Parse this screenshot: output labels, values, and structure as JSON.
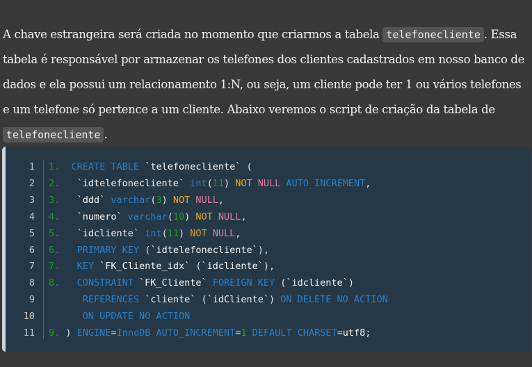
{
  "paragraph": {
    "t1": "A chave estrangeira será criada no momento que criarmos a tabela ",
    "c1": "telefonecliente",
    "t2": ". Essa tabela é responsável por armazenar os telefones dos clientes cadastrados em nosso banco de dados e ela possui um relacionamento 1:N, ou seja, um cliente pode ter 1 ou vários telefones e um telefone só pertence a um cliente. Abaixo veremos o script de criação da tabela de ",
    "c2": "telefonecliente",
    "t3": "."
  },
  "code": {
    "line_numbers": [
      "1",
      "2",
      "3",
      "4",
      "5",
      "6",
      "7",
      "8",
      "9",
      "10",
      "11"
    ],
    "lines": [
      [
        {
          "c": "cm",
          "t": "1.  "
        },
        {
          "c": "kw",
          "t": "CREATE TABLE "
        },
        {
          "c": "wt",
          "t": "`telefonecliente` "
        },
        {
          "c": "",
          "t": "("
        }
      ],
      [
        {
          "c": "cm",
          "t": "2.   "
        },
        {
          "c": "wt",
          "t": "`idtelefonecliente` "
        },
        {
          "c": "kw",
          "t": "int"
        },
        {
          "c": "",
          "t": "("
        },
        {
          "c": "num",
          "t": "11"
        },
        {
          "c": "",
          "t": ") "
        },
        {
          "c": "yl",
          "t": "NOT "
        },
        {
          "c": "pk",
          "t": "NULL "
        },
        {
          "c": "kw",
          "t": "AUTO_INCREMENT"
        },
        {
          "c": "",
          "t": ","
        }
      ],
      [
        {
          "c": "cm",
          "t": "3.   "
        },
        {
          "c": "wt",
          "t": "`ddd` "
        },
        {
          "c": "kw",
          "t": "varchar"
        },
        {
          "c": "",
          "t": "("
        },
        {
          "c": "num",
          "t": "3"
        },
        {
          "c": "",
          "t": ") "
        },
        {
          "c": "yl",
          "t": "NOT "
        },
        {
          "c": "pk",
          "t": "NULL"
        },
        {
          "c": "",
          "t": ","
        }
      ],
      [
        {
          "c": "cm",
          "t": "4.   "
        },
        {
          "c": "wt",
          "t": "`numero` "
        },
        {
          "c": "kw",
          "t": "varchar"
        },
        {
          "c": "",
          "t": "("
        },
        {
          "c": "num",
          "t": "10"
        },
        {
          "c": "",
          "t": ") "
        },
        {
          "c": "yl",
          "t": "NOT "
        },
        {
          "c": "pk",
          "t": "NULL"
        },
        {
          "c": "",
          "t": ","
        }
      ],
      [
        {
          "c": "cm",
          "t": "5.   "
        },
        {
          "c": "wt",
          "t": "`idcliente` "
        },
        {
          "c": "kw",
          "t": "int"
        },
        {
          "c": "",
          "t": "("
        },
        {
          "c": "num",
          "t": "11"
        },
        {
          "c": "",
          "t": ") "
        },
        {
          "c": "yl",
          "t": "NOT "
        },
        {
          "c": "pk",
          "t": "NULL"
        },
        {
          "c": "",
          "t": ","
        }
      ],
      [
        {
          "c": "cm",
          "t": "6.   "
        },
        {
          "c": "kw",
          "t": "PRIMARY KEY "
        },
        {
          "c": "",
          "t": "("
        },
        {
          "c": "wt",
          "t": "`idtelefonecliente`"
        },
        {
          "c": "",
          "t": "),"
        }
      ],
      [
        {
          "c": "cm",
          "t": "7.   "
        },
        {
          "c": "kw",
          "t": "KEY "
        },
        {
          "c": "wt",
          "t": "`FK_Cliente_idx` "
        },
        {
          "c": "",
          "t": "("
        },
        {
          "c": "wt",
          "t": "`idcliente`"
        },
        {
          "c": "",
          "t": "),"
        }
      ],
      [
        {
          "c": "cm",
          "t": "8.   "
        },
        {
          "c": "kw",
          "t": "CONSTRAINT "
        },
        {
          "c": "wt",
          "t": "`FK_Cliente` "
        },
        {
          "c": "kw",
          "t": "FOREIGN KEY "
        },
        {
          "c": "",
          "t": "("
        },
        {
          "c": "wt",
          "t": "`idcliente`"
        },
        {
          "c": "",
          "t": ")"
        }
      ],
      [
        {
          "c": "",
          "t": "      "
        },
        {
          "c": "kw",
          "t": "REFERENCES "
        },
        {
          "c": "wt",
          "t": "`cliente` "
        },
        {
          "c": "",
          "t": "("
        },
        {
          "c": "wt",
          "t": "`idCliente`"
        },
        {
          "c": "",
          "t": ") "
        },
        {
          "c": "kw",
          "t": "ON DELETE NO ACTION"
        }
      ],
      [
        {
          "c": "",
          "t": "      "
        },
        {
          "c": "kw",
          "t": "ON UPDATE NO ACTION"
        }
      ],
      [
        {
          "c": "cm",
          "t": "9. "
        },
        {
          "c": "",
          "t": ") "
        },
        {
          "c": "kw",
          "t": "ENGINE"
        },
        {
          "c": "",
          "t": "="
        },
        {
          "c": "kw",
          "t": "InnoDB AUTO_INCREMENT"
        },
        {
          "c": "",
          "t": "="
        },
        {
          "c": "num",
          "t": "1 "
        },
        {
          "c": "kw",
          "t": "DEFAULT CHARSET"
        },
        {
          "c": "",
          "t": "="
        },
        {
          "c": "wt",
          "t": "utf8"
        },
        {
          "c": "",
          "t": ";"
        }
      ]
    ]
  }
}
